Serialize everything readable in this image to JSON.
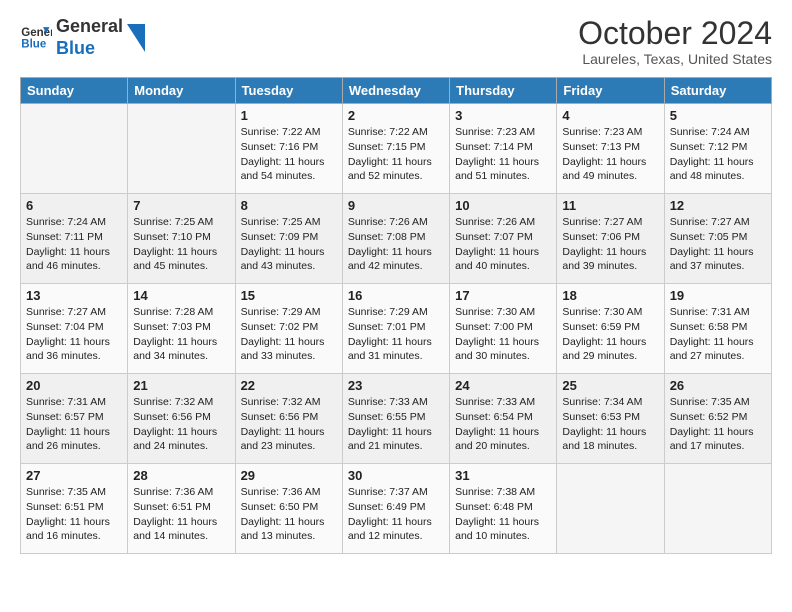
{
  "logo": {
    "line1": "General",
    "line2": "Blue"
  },
  "title": "October 2024",
  "location": "Laureles, Texas, United States",
  "days_of_week": [
    "Sunday",
    "Monday",
    "Tuesday",
    "Wednesday",
    "Thursday",
    "Friday",
    "Saturday"
  ],
  "weeks": [
    [
      {
        "day": "",
        "sunrise": "",
        "sunset": "",
        "daylight": ""
      },
      {
        "day": "",
        "sunrise": "",
        "sunset": "",
        "daylight": ""
      },
      {
        "day": "1",
        "sunrise": "Sunrise: 7:22 AM",
        "sunset": "Sunset: 7:16 PM",
        "daylight": "Daylight: 11 hours and 54 minutes."
      },
      {
        "day": "2",
        "sunrise": "Sunrise: 7:22 AM",
        "sunset": "Sunset: 7:15 PM",
        "daylight": "Daylight: 11 hours and 52 minutes."
      },
      {
        "day": "3",
        "sunrise": "Sunrise: 7:23 AM",
        "sunset": "Sunset: 7:14 PM",
        "daylight": "Daylight: 11 hours and 51 minutes."
      },
      {
        "day": "4",
        "sunrise": "Sunrise: 7:23 AM",
        "sunset": "Sunset: 7:13 PM",
        "daylight": "Daylight: 11 hours and 49 minutes."
      },
      {
        "day": "5",
        "sunrise": "Sunrise: 7:24 AM",
        "sunset": "Sunset: 7:12 PM",
        "daylight": "Daylight: 11 hours and 48 minutes."
      }
    ],
    [
      {
        "day": "6",
        "sunrise": "Sunrise: 7:24 AM",
        "sunset": "Sunset: 7:11 PM",
        "daylight": "Daylight: 11 hours and 46 minutes."
      },
      {
        "day": "7",
        "sunrise": "Sunrise: 7:25 AM",
        "sunset": "Sunset: 7:10 PM",
        "daylight": "Daylight: 11 hours and 45 minutes."
      },
      {
        "day": "8",
        "sunrise": "Sunrise: 7:25 AM",
        "sunset": "Sunset: 7:09 PM",
        "daylight": "Daylight: 11 hours and 43 minutes."
      },
      {
        "day": "9",
        "sunrise": "Sunrise: 7:26 AM",
        "sunset": "Sunset: 7:08 PM",
        "daylight": "Daylight: 11 hours and 42 minutes."
      },
      {
        "day": "10",
        "sunrise": "Sunrise: 7:26 AM",
        "sunset": "Sunset: 7:07 PM",
        "daylight": "Daylight: 11 hours and 40 minutes."
      },
      {
        "day": "11",
        "sunrise": "Sunrise: 7:27 AM",
        "sunset": "Sunset: 7:06 PM",
        "daylight": "Daylight: 11 hours and 39 minutes."
      },
      {
        "day": "12",
        "sunrise": "Sunrise: 7:27 AM",
        "sunset": "Sunset: 7:05 PM",
        "daylight": "Daylight: 11 hours and 37 minutes."
      }
    ],
    [
      {
        "day": "13",
        "sunrise": "Sunrise: 7:27 AM",
        "sunset": "Sunset: 7:04 PM",
        "daylight": "Daylight: 11 hours and 36 minutes."
      },
      {
        "day": "14",
        "sunrise": "Sunrise: 7:28 AM",
        "sunset": "Sunset: 7:03 PM",
        "daylight": "Daylight: 11 hours and 34 minutes."
      },
      {
        "day": "15",
        "sunrise": "Sunrise: 7:29 AM",
        "sunset": "Sunset: 7:02 PM",
        "daylight": "Daylight: 11 hours and 33 minutes."
      },
      {
        "day": "16",
        "sunrise": "Sunrise: 7:29 AM",
        "sunset": "Sunset: 7:01 PM",
        "daylight": "Daylight: 11 hours and 31 minutes."
      },
      {
        "day": "17",
        "sunrise": "Sunrise: 7:30 AM",
        "sunset": "Sunset: 7:00 PM",
        "daylight": "Daylight: 11 hours and 30 minutes."
      },
      {
        "day": "18",
        "sunrise": "Sunrise: 7:30 AM",
        "sunset": "Sunset: 6:59 PM",
        "daylight": "Daylight: 11 hours and 29 minutes."
      },
      {
        "day": "19",
        "sunrise": "Sunrise: 7:31 AM",
        "sunset": "Sunset: 6:58 PM",
        "daylight": "Daylight: 11 hours and 27 minutes."
      }
    ],
    [
      {
        "day": "20",
        "sunrise": "Sunrise: 7:31 AM",
        "sunset": "Sunset: 6:57 PM",
        "daylight": "Daylight: 11 hours and 26 minutes."
      },
      {
        "day": "21",
        "sunrise": "Sunrise: 7:32 AM",
        "sunset": "Sunset: 6:56 PM",
        "daylight": "Daylight: 11 hours and 24 minutes."
      },
      {
        "day": "22",
        "sunrise": "Sunrise: 7:32 AM",
        "sunset": "Sunset: 6:56 PM",
        "daylight": "Daylight: 11 hours and 23 minutes."
      },
      {
        "day": "23",
        "sunrise": "Sunrise: 7:33 AM",
        "sunset": "Sunset: 6:55 PM",
        "daylight": "Daylight: 11 hours and 21 minutes."
      },
      {
        "day": "24",
        "sunrise": "Sunrise: 7:33 AM",
        "sunset": "Sunset: 6:54 PM",
        "daylight": "Daylight: 11 hours and 20 minutes."
      },
      {
        "day": "25",
        "sunrise": "Sunrise: 7:34 AM",
        "sunset": "Sunset: 6:53 PM",
        "daylight": "Daylight: 11 hours and 18 minutes."
      },
      {
        "day": "26",
        "sunrise": "Sunrise: 7:35 AM",
        "sunset": "Sunset: 6:52 PM",
        "daylight": "Daylight: 11 hours and 17 minutes."
      }
    ],
    [
      {
        "day": "27",
        "sunrise": "Sunrise: 7:35 AM",
        "sunset": "Sunset: 6:51 PM",
        "daylight": "Daylight: 11 hours and 16 minutes."
      },
      {
        "day": "28",
        "sunrise": "Sunrise: 7:36 AM",
        "sunset": "Sunset: 6:51 PM",
        "daylight": "Daylight: 11 hours and 14 minutes."
      },
      {
        "day": "29",
        "sunrise": "Sunrise: 7:36 AM",
        "sunset": "Sunset: 6:50 PM",
        "daylight": "Daylight: 11 hours and 13 minutes."
      },
      {
        "day": "30",
        "sunrise": "Sunrise: 7:37 AM",
        "sunset": "Sunset: 6:49 PM",
        "daylight": "Daylight: 11 hours and 12 minutes."
      },
      {
        "day": "31",
        "sunrise": "Sunrise: 7:38 AM",
        "sunset": "Sunset: 6:48 PM",
        "daylight": "Daylight: 11 hours and 10 minutes."
      },
      {
        "day": "",
        "sunrise": "",
        "sunset": "",
        "daylight": ""
      },
      {
        "day": "",
        "sunrise": "",
        "sunset": "",
        "daylight": ""
      }
    ]
  ]
}
